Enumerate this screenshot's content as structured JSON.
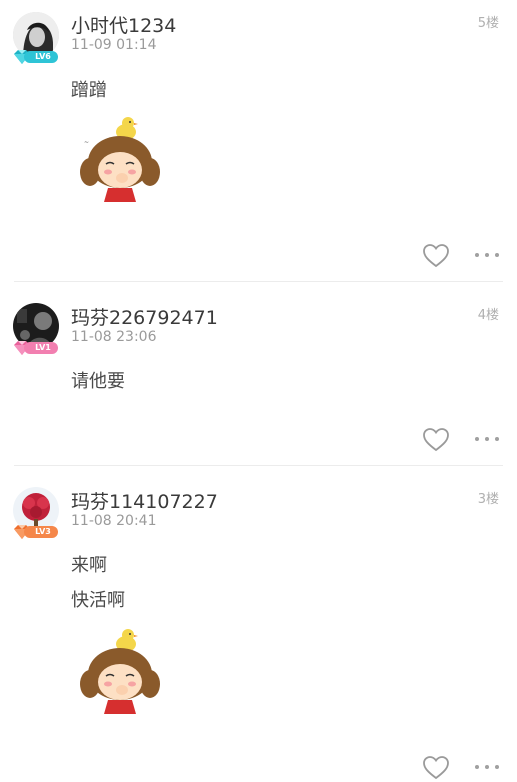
{
  "posts": [
    {
      "username": "小时代1234",
      "time": "11-09 01:14",
      "floor": "5楼",
      "level": "LV6",
      "level_color": "#2ec4d6",
      "content": [
        "蹭蹭"
      ],
      "has_sticker": true,
      "avatar_icon": "girl-portrait-avatar"
    },
    {
      "username": "玛芬226792471",
      "time": "11-08 23:06",
      "floor": "4楼",
      "level": "LV1",
      "level_color": "#f27fb0",
      "content": [
        "请他要"
      ],
      "has_sticker": false,
      "avatar_icon": "dark-photo-avatar"
    },
    {
      "username": "玛芬114107227",
      "time": "11-08 20:41",
      "floor": "3楼",
      "level": "LV3",
      "level_color": "#f5874a",
      "content": [
        "来啊",
        "快活啊"
      ],
      "has_sticker": true,
      "avatar_icon": "red-heart-tree-avatar"
    }
  ],
  "icons": {
    "like": "heart-outline-icon",
    "more": "more-dots-icon",
    "sticker": "cartoon-girl-sticker"
  }
}
